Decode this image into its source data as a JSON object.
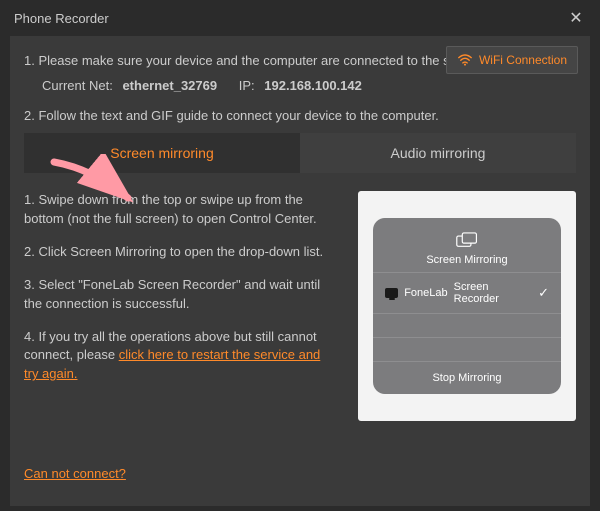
{
  "window": {
    "title": "Phone Recorder"
  },
  "wifi_button": "WiFi Connection",
  "step1_text": "1. Please make sure your device and the computer are connected to the same WLAN.",
  "net": {
    "current_label": "Current Net:",
    "current_value": "ethernet_32769",
    "ip_label": "IP:",
    "ip_value": "192.168.100.142"
  },
  "step2_text": "2. Follow the text and GIF guide to connect your device to the computer.",
  "tabs": {
    "screen": "Screen mirroring",
    "audio": "Audio mirroring"
  },
  "substeps": {
    "s1": "1. Swipe down from the top or swipe up from the bottom (not the full screen) to open Control Center.",
    "s2": "2. Click Screen Mirroring to open the drop-down list.",
    "s3": "3. Select \"FoneLab Screen Recorder\" and wait until the connection is successful.",
    "s4_a": "4. If you try all the operations above but still cannot connect, please ",
    "s4_link": "click here to restart the service and try again."
  },
  "preview": {
    "panel_title": "Screen Mirroring",
    "device_prefix": "FoneLab",
    "device_name": "Screen Recorder",
    "stop": "Stop Mirroring"
  },
  "footer": {
    "cannot_connect": "Can not connect?"
  }
}
